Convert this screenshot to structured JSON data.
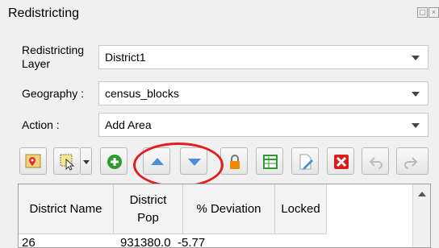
{
  "panel": {
    "title": "Redistricting"
  },
  "form": {
    "layer_label_line1": "Redistricting",
    "layer_label_line2": "Layer",
    "layer_value": "District1",
    "geography_label": "Geography :",
    "geography_value": "census_blocks",
    "action_label": "Action :",
    "action_value": "Add Area"
  },
  "toolbar": {
    "icons": [
      "map-pin-icon",
      "select-features-icon",
      "add-district-icon",
      "move-up-icon",
      "move-down-icon",
      "lock-icon",
      "table-icon",
      "edit-document-icon",
      "delete-icon",
      "undo-icon",
      "redo-icon"
    ]
  },
  "table": {
    "headers": {
      "district_name": "District Name",
      "district_pop_line1": "District",
      "district_pop_line2": "Pop",
      "deviation": "% Deviation",
      "locked": "Locked"
    },
    "rows": [
      {
        "name": "26",
        "pop": "931380.0",
        "deviation": "-5.77",
        "locked": ""
      }
    ]
  },
  "colors": {
    "highlight_circle": "#e02020",
    "up_down_arrows": "#4a90d9",
    "add_green": "#2e9b2e",
    "lock_orange": "#f08a00",
    "delete_red": "#d62020"
  }
}
